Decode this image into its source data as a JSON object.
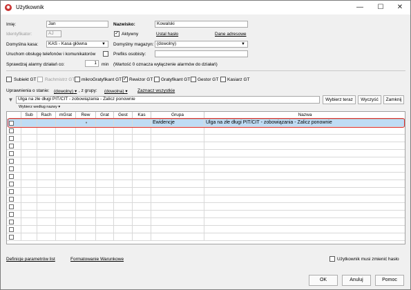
{
  "window": {
    "title": "Użytkownik",
    "icon": "app-logo-icon",
    "controls": [
      "minimize-icon",
      "maximize-icon",
      "close-icon"
    ]
  },
  "form": {
    "imie_label": "Imię:",
    "imie_value": "Jan",
    "nazwisko_label": "Nazwisko:",
    "nazwisko_value": "Kowalski",
    "identyfikator_label": "Identyfikator:",
    "identyfikator_value": "AJ",
    "aktywny_label": "Aktywny",
    "aktywny_checked": "✓",
    "ustal_haslo": "Ustal hasło",
    "dane_adresowe": "Dane adresowe",
    "kasa_label": "Domyślna kasa:",
    "kasa_value": "KAS - Kasa główna",
    "magazyn_label": "Domyślny magazyn:",
    "magazyn_value": "(dowolny)",
    "telefon_label": "Uruchom obsługę telefonów i komunikatorów",
    "prefiks_label": "Prefiks osobisty:",
    "prefiks_value": "",
    "alarm_label": "Sprawdzaj alarmy działań co:",
    "alarm_value": "1",
    "alarm_unit": "min",
    "alarm_note": "(Wartość 0 oznacza wyłączenie alarmów do działań)"
  },
  "roles": [
    {
      "label": "Subiekt GT",
      "checked": "",
      "disabled": false
    },
    {
      "label": "Rachmistrz GT",
      "checked": "",
      "disabled": true
    },
    {
      "label": "mikroGratyfikant GT",
      "checked": "",
      "disabled": false
    },
    {
      "label": "Rewizor GT",
      "checked": "✓",
      "disabled": false
    },
    {
      "label": "Gratyfikant GT",
      "checked": "",
      "disabled": false
    },
    {
      "label": "Gestor GT",
      "checked": "",
      "disabled": false
    },
    {
      "label": "Kasiarz GT",
      "checked": "",
      "disabled": false
    }
  ],
  "filters": {
    "stan_label": "Uprawnienia o stanie:",
    "stan_value": "(dowolny)",
    "grupa_label": ", z grupy:",
    "grupa_value": "(dowolna)",
    "zaznacz": "Zaznacz wszystkie",
    "search_value": "Ulga na złe długi PIT/CIT - zobowiązania - Zalicz ponownie",
    "wybierz_teraz": "Wybierz teraz",
    "wyczysc": "Wyczyść",
    "zamknij": "Zamknij",
    "sort_label": "Wybierz według nazwy"
  },
  "grid": {
    "columns": [
      "Sub",
      "Rach",
      "mGrat",
      "Rew",
      "Grat",
      "Gest",
      "Kas",
      "Grupa",
      "Nazwa"
    ],
    "selected_row": {
      "rew_dot": "●",
      "grupa": "Ewidencje",
      "nazwa": "Ulga na złe długi PIT/CIT - zobowiązania - Zalicz ponownie"
    }
  },
  "footer": {
    "definicje": "Definicje parametrów list",
    "formatowanie": "Formatowanie Warunkowe",
    "musi_zmienic": "Użytkownik musi zmienić hasło",
    "ok": "OK",
    "anuluj": "Anuluj",
    "pomoc": "Pomoc"
  },
  "colors": {
    "selected_row": "#bfdcf4",
    "highlight_border": "#e0302c",
    "logo": "#c8302f"
  }
}
